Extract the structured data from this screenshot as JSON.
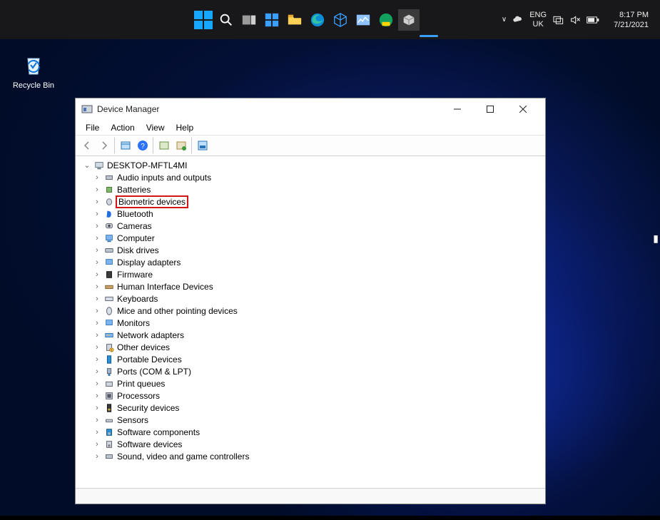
{
  "taskbar": {
    "lang_top": "ENG",
    "lang_bot": "UK",
    "time": "8:17 PM",
    "date": "7/21/2021"
  },
  "desktop": {
    "recycle_label": "Recycle Bin"
  },
  "window": {
    "title": "Device Manager",
    "menus": {
      "file": "File",
      "action": "Action",
      "view": "View",
      "help": "Help"
    },
    "root": "DESKTOP-MFTL4MI",
    "categories": [
      "Audio inputs and outputs",
      "Batteries",
      "Biometric devices",
      "Bluetooth",
      "Cameras",
      "Computer",
      "Disk drives",
      "Display adapters",
      "Firmware",
      "Human Interface Devices",
      "Keyboards",
      "Mice and other pointing devices",
      "Monitors",
      "Network adapters",
      "Other devices",
      "Portable Devices",
      "Ports (COM & LPT)",
      "Print queues",
      "Processors",
      "Security devices",
      "Sensors",
      "Software components",
      "Software devices",
      "Sound, video and game controllers"
    ],
    "highlighted_index": 2
  }
}
